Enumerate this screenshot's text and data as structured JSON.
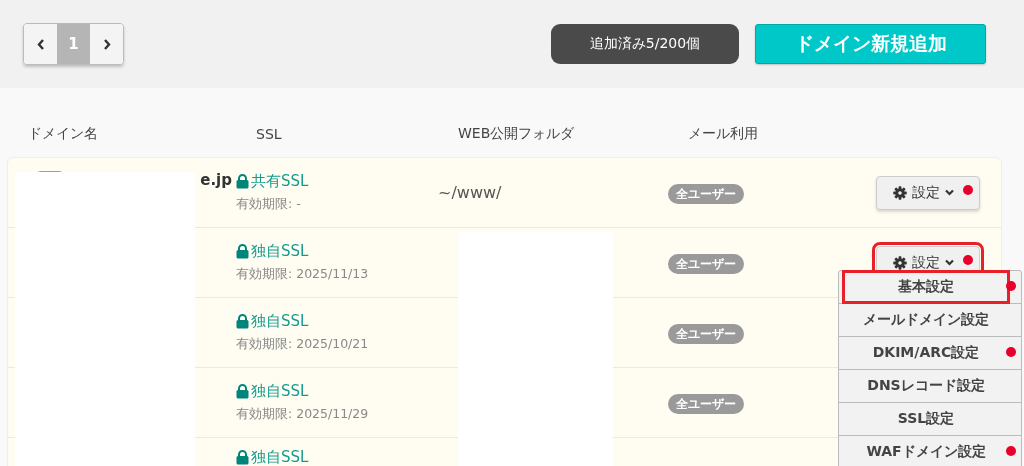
{
  "pager": {
    "pages": [
      {
        "label": "1",
        "selected": true
      }
    ]
  },
  "counter": "追加済み5/200個",
  "add_button": "ドメイン新規追加",
  "table": {
    "columns": [
      "ドメイン名",
      "SSL",
      "WEB公開フォルダ",
      "メール利用"
    ],
    "rows": [
      {
        "domain": "e.jp",
        "ssl_type": "共有SSL",
        "ssl_expiry": "有効期限: -",
        "folder": "~/www/",
        "mail": "全ユーザー",
        "settings": {
          "label": "設定",
          "dot": true,
          "highlighted": false
        }
      },
      {
        "domain": "",
        "ssl_type": "独自SSL",
        "ssl_expiry": "有効期限: 2025/11/13",
        "folder": "",
        "mail": "全ユーザー",
        "settings": {
          "label": "設定",
          "dot": true,
          "highlighted": true
        }
      },
      {
        "domain": "",
        "ssl_type": "独自SSL",
        "ssl_expiry": "有効期限: 2025/10/21",
        "folder": "",
        "mail": "全ユーザー",
        "settings": null
      },
      {
        "domain": "",
        "ssl_type": "独自SSL",
        "ssl_expiry": "有効期限: 2025/11/29",
        "folder": "",
        "mail": "全ユーザー",
        "settings": null
      },
      {
        "domain": "",
        "ssl_type": "独自SSL",
        "ssl_expiry": "",
        "folder": "",
        "mail": "",
        "settings": null
      }
    ]
  },
  "menu": {
    "items": [
      {
        "label": "基本設定",
        "dot": true,
        "highlighted": true
      },
      {
        "label": "メールドメイン設定",
        "dot": false,
        "highlighted": false
      },
      {
        "label": "DKIM/ARC設定",
        "dot": true,
        "highlighted": false
      },
      {
        "label": "DNSレコード設定",
        "dot": false,
        "highlighted": false
      },
      {
        "label": "SSL設定",
        "dot": false,
        "highlighted": false
      },
      {
        "label": "WAFドメイン設定",
        "dot": true,
        "highlighted": false
      }
    ]
  }
}
